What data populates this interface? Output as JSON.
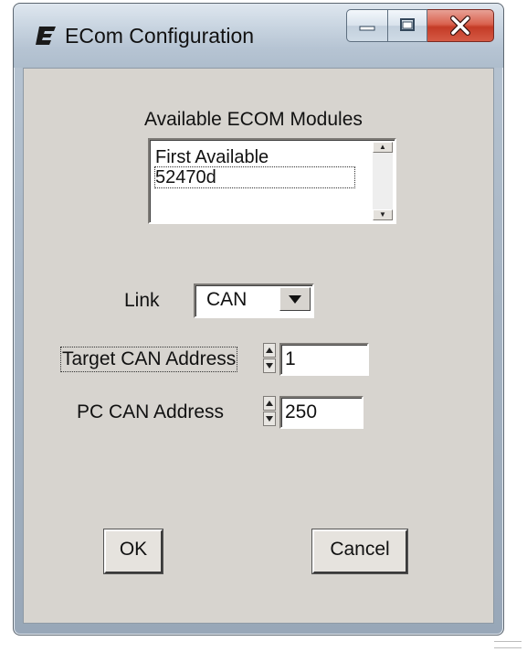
{
  "window": {
    "title": "ECom Configuration",
    "icon": "ecom-app-icon",
    "caption_buttons": [
      "minimize-icon",
      "maximize-icon",
      "close-icon"
    ]
  },
  "modules": {
    "heading": "Available  ECOM Modules",
    "items": [
      "First Available",
      "52470d"
    ]
  },
  "link": {
    "label": "Link",
    "selected": "CAN"
  },
  "target_can": {
    "label": "Target CAN Address",
    "value": "1"
  },
  "pc_can": {
    "label": "PC CAN Address",
    "value": "250"
  },
  "buttons": {
    "ok": "OK",
    "cancel": "Cancel"
  },
  "colors": {
    "dialog_bg": "#d7d4cf",
    "close_button": "#c43b26"
  }
}
